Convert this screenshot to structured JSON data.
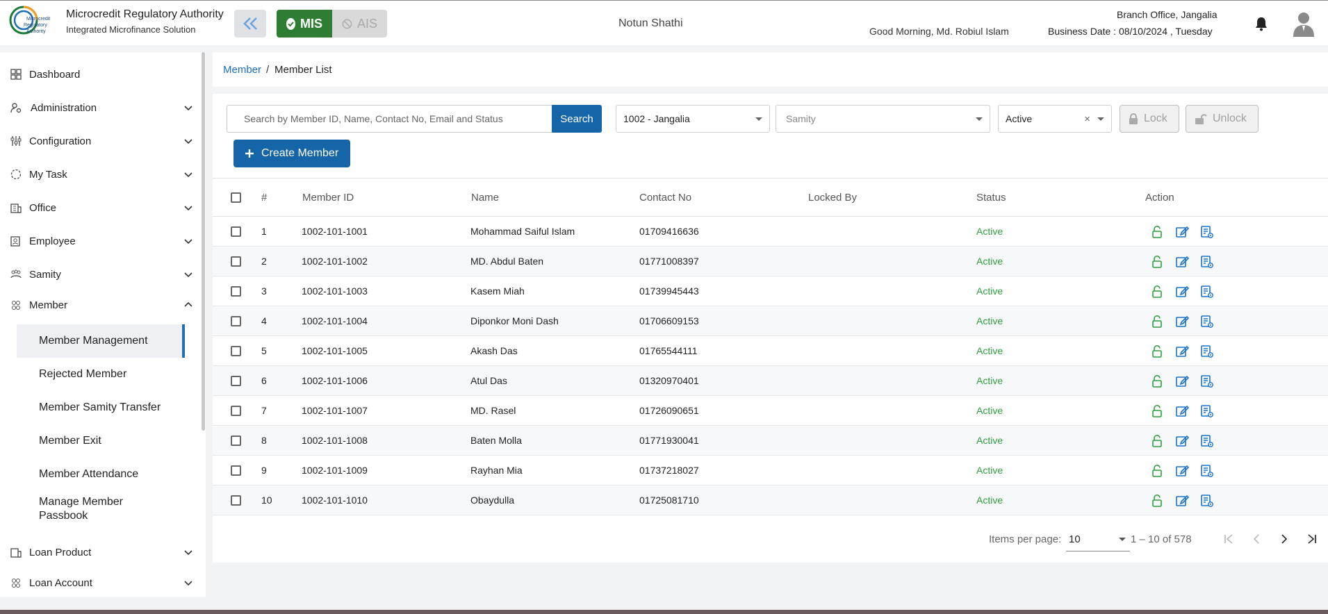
{
  "header": {
    "org_name": "Microcredit Regulatory Authority",
    "org_sub": "Integrated Microfinance Solution",
    "logo_text": "Microcredit Regulatory Authority",
    "mode_mis": "MIS",
    "mode_ais": "AIS",
    "app_name": "Notun Shathi",
    "greeting": "Good Morning, Md. Robiul Islam",
    "branch": "Branch Office, Jangalia",
    "business_date": "Business Date : 08/10/2024 , Tuesday",
    "colors": {
      "brand_green": "#2e7d32",
      "primary_blue": "#1565a8"
    }
  },
  "sidebar": {
    "items": [
      {
        "label": "Dashboard",
        "icon": "dashboard-icon"
      },
      {
        "label": "Administration",
        "icon": "administration-icon"
      },
      {
        "label": "Configuration",
        "icon": "configuration-icon"
      },
      {
        "label": "My Task",
        "icon": "task-icon"
      },
      {
        "label": "Office",
        "icon": "office-icon"
      },
      {
        "label": "Employee",
        "icon": "employee-icon"
      },
      {
        "label": "Samity",
        "icon": "samity-icon"
      },
      {
        "label": "Member",
        "icon": "member-icon"
      },
      {
        "label": "Loan Product",
        "icon": "loan-product-icon"
      },
      {
        "label": "Loan Account",
        "icon": "loan-account-icon"
      }
    ],
    "member_sub": [
      {
        "label": "Member Management"
      },
      {
        "label": "Rejected Member"
      },
      {
        "label": "Member Samity Transfer"
      },
      {
        "label": "Member Exit"
      },
      {
        "label": "Member Attendance"
      },
      {
        "label": "Manage Member Passbook"
      }
    ]
  },
  "breadcrumb": {
    "parent": "Member",
    "separator": "/",
    "current": "Member List"
  },
  "filters": {
    "search_placeholder": "Search by Member ID, Name, Contact No, Email and Status",
    "search_label": "Search",
    "branch_value": "1002 - Jangalia",
    "samity_placeholder": "Samity",
    "status_value": "Active",
    "lock_label": "Lock",
    "unlock_label": "Unlock",
    "create_label": "Create Member"
  },
  "table": {
    "headers": {
      "num": "#",
      "member_id": "Member ID",
      "name": "Name",
      "contact": "Contact No",
      "locked_by": "Locked By",
      "status": "Status",
      "action": "Action"
    },
    "rows": [
      {
        "num": "1",
        "member_id": "1002-101-1001",
        "name": "Mohammad Saiful Islam",
        "contact": "01709416636",
        "locked_by": "",
        "status": "Active"
      },
      {
        "num": "2",
        "member_id": "1002-101-1002",
        "name": "MD. Abdul Baten",
        "contact": "01771008397",
        "locked_by": "",
        "status": "Active"
      },
      {
        "num": "3",
        "member_id": "1002-101-1003",
        "name": "Kasem Miah",
        "contact": "01739945443",
        "locked_by": "",
        "status": "Active"
      },
      {
        "num": "4",
        "member_id": "1002-101-1004",
        "name": "Diponkor Moni Dash",
        "contact": "01706609153",
        "locked_by": "",
        "status": "Active"
      },
      {
        "num": "5",
        "member_id": "1002-101-1005",
        "name": "Akash Das",
        "contact": "01765544111",
        "locked_by": "",
        "status": "Active"
      },
      {
        "num": "6",
        "member_id": "1002-101-1006",
        "name": "Atul Das",
        "contact": "01320970401",
        "locked_by": "",
        "status": "Active"
      },
      {
        "num": "7",
        "member_id": "1002-101-1007",
        "name": "MD. Rasel",
        "contact": "01726090651",
        "locked_by": "",
        "status": "Active"
      },
      {
        "num": "8",
        "member_id": "1002-101-1008",
        "name": "Baten Molla",
        "contact": "01771930041",
        "locked_by": "",
        "status": "Active"
      },
      {
        "num": "9",
        "member_id": "1002-101-1009",
        "name": "Rayhan Mia",
        "contact": "01737218027",
        "locked_by": "",
        "status": "Active"
      },
      {
        "num": "10",
        "member_id": "1002-101-1010",
        "name": "Obaydulla",
        "contact": "01725081710",
        "locked_by": "",
        "status": "Active"
      }
    ]
  },
  "pagination": {
    "items_per_page_label": "Items per page:",
    "items_per_page": "10",
    "range": "1 – 10 of 578"
  }
}
